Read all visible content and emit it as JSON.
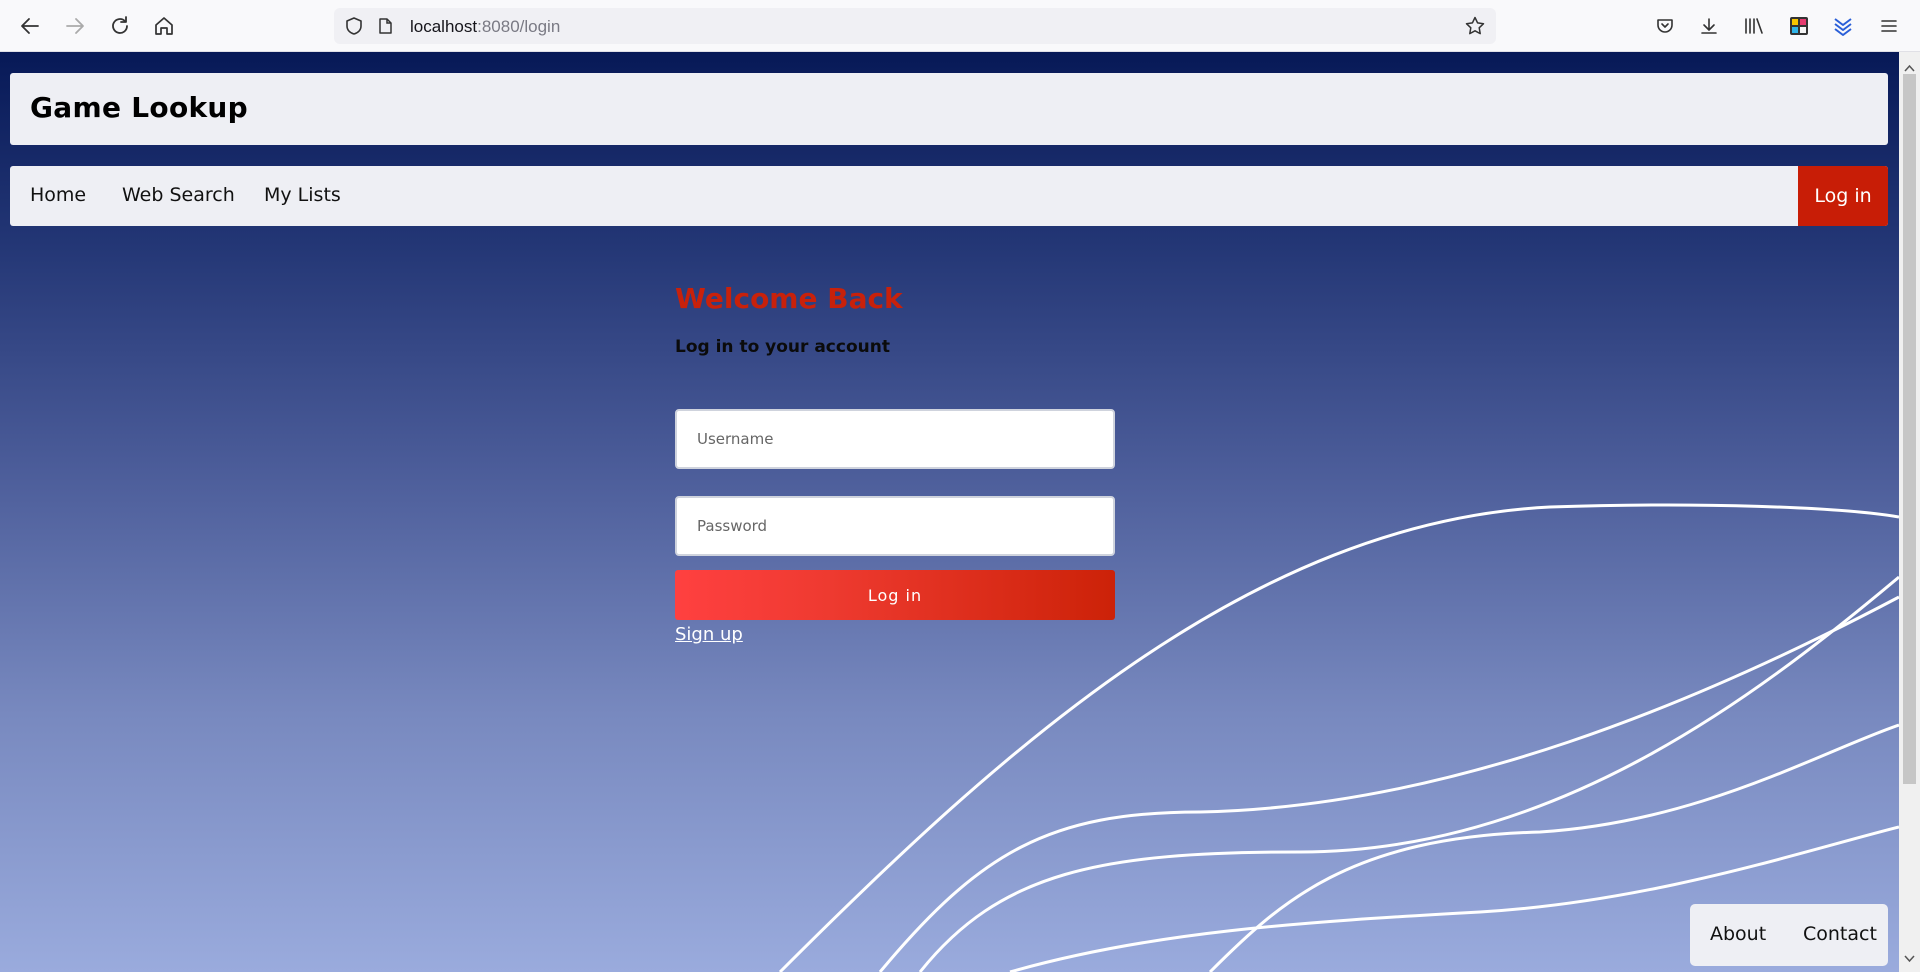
{
  "browser": {
    "url_host": "localhost",
    "url_rest": ":8080/login"
  },
  "site": {
    "title": "Game Lookup"
  },
  "nav": {
    "items": [
      {
        "label": "Home"
      },
      {
        "label": "Web Search"
      },
      {
        "label": "My Lists"
      }
    ],
    "login_label": "Log in"
  },
  "login": {
    "heading": "Welcome Back",
    "subheading": "Log in to your account",
    "username_placeholder": "Username",
    "password_placeholder": "Password",
    "submit_label": "Log in",
    "signup_label": "Sign up"
  },
  "footer": {
    "about_label": "About",
    "contact_label": "Contact"
  },
  "colors": {
    "accent_red": "#c81d06",
    "heading_red": "#c8210b",
    "panel": "#eeeff4"
  }
}
